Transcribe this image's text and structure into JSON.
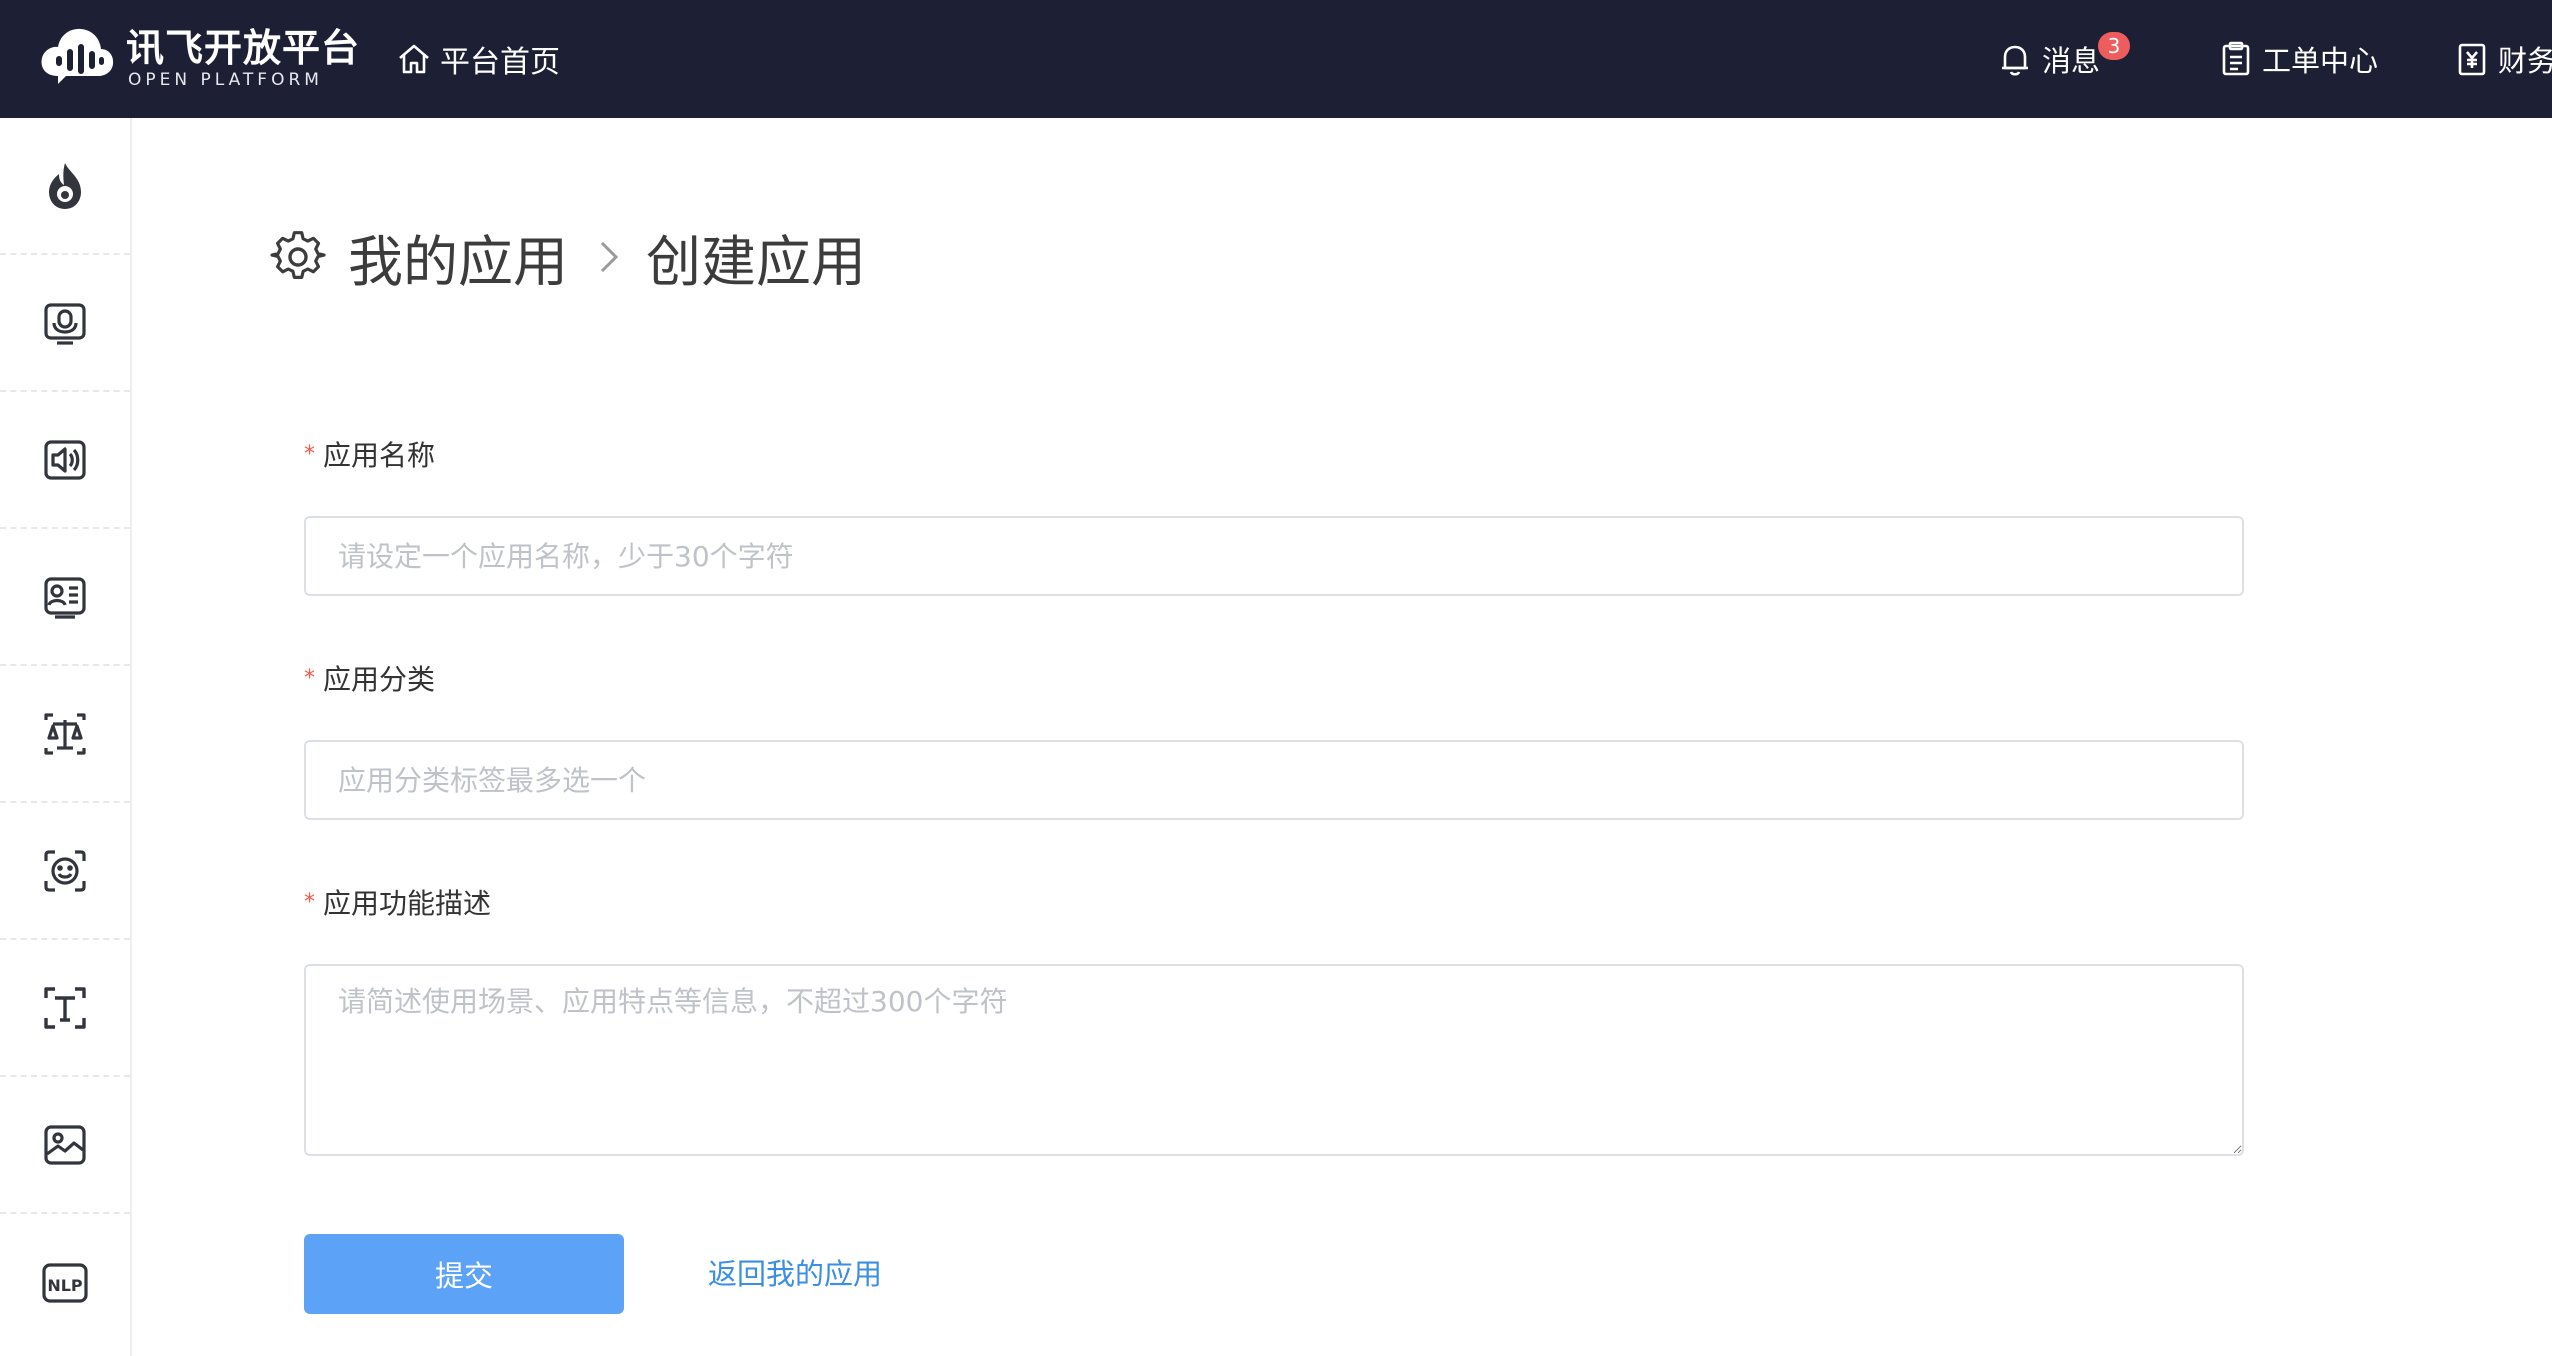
{
  "header": {
    "logo_cn": "讯飞开放平台",
    "logo_en": "OPEN PLATFORM",
    "home_label": "平台首页",
    "messages_label": "消息",
    "messages_badge": "3",
    "workorder_label": "工单中心",
    "finance_label": "财务"
  },
  "sidebar": {
    "items": [
      {
        "icon": "flame-icon"
      },
      {
        "icon": "speech-recognition-icon"
      },
      {
        "icon": "speech-synthesis-icon"
      },
      {
        "icon": "voice-transcription-icon"
      },
      {
        "icon": "voiceprint-compare-icon"
      },
      {
        "icon": "face-recognition-icon"
      },
      {
        "icon": "text-recognition-icon"
      },
      {
        "icon": "image-recognition-icon"
      },
      {
        "icon": "nlp-icon",
        "text": "NLP"
      }
    ]
  },
  "breadcrumb": {
    "parent": "我的应用",
    "current": "创建应用"
  },
  "form": {
    "required_mark": "*",
    "name_label": "应用名称",
    "name_placeholder": "请设定一个应用名称，少于30个字符",
    "category_label": "应用分类",
    "category_placeholder": "应用分类标签最多选一个",
    "desc_label": "应用功能描述",
    "desc_placeholder": "请简述使用场景、应用特点等信息，不超过300个字符",
    "submit_label": "提交",
    "back_label": "返回我的应用"
  },
  "colors": {
    "topbar": "#1d2034",
    "primary_button": "#5ca2f7",
    "link": "#3a8ee6",
    "required": "#f05a4c",
    "badge": "#ed5d5d"
  }
}
